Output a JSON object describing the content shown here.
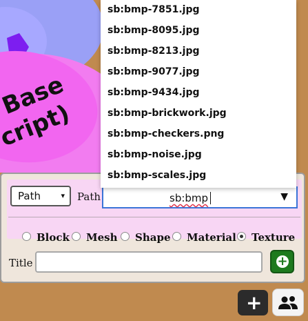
{
  "scene": {
    "sign_text_line1": "Base",
    "sign_text_line2": "cript)"
  },
  "dropdown": {
    "options": [
      "sb:bmp-7851.jpg",
      "sb:bmp-8095.jpg",
      "sb:bmp-8213.jpg",
      "sb:bmp-9077.jpg",
      "sb:bmp-9434.jpg",
      "sb:bmp-brickwork.jpg",
      "sb:bmp-checkers.png",
      "sb:bmp-noise.jpg",
      "sb:bmp-scales.jpg"
    ]
  },
  "panel": {
    "mode_select": {
      "value": "Path",
      "arrow": "▾"
    },
    "path_label": "Path",
    "path_input": {
      "value": "sb:bmp",
      "arrow": "▼"
    },
    "radios": [
      {
        "label": "Block",
        "checked": false
      },
      {
        "label": "Mesh",
        "checked": false
      },
      {
        "label": "Shape",
        "checked": false
      },
      {
        "label": "Material",
        "checked": false
      },
      {
        "label": "Texture",
        "checked": true
      }
    ],
    "title_label": "Title",
    "title_input": {
      "value": "",
      "placeholder": ""
    },
    "add_button_icon": "plus-circle-icon"
  },
  "toolbar": {
    "plus_button_icon": "plus-icon",
    "plus_symbol": "+",
    "people_button_icon": "people-icon"
  },
  "colors": {
    "background": "#c08a4f",
    "panel_band": "#f8d6f4",
    "add_button": "#1e7a1e",
    "input_focus_border": "#3a74d8"
  }
}
